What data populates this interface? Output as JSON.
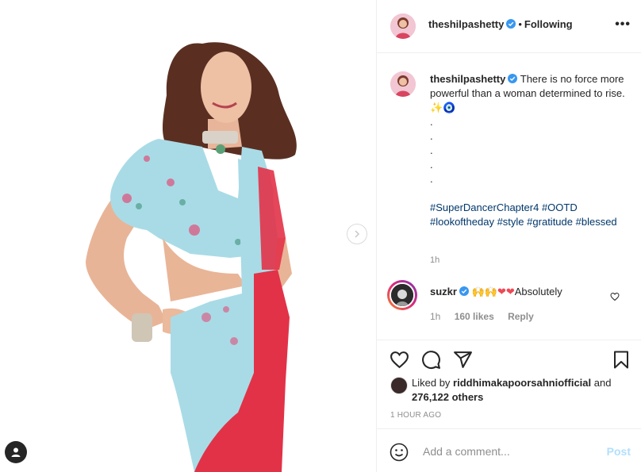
{
  "post": {
    "username": "theshilpashetty",
    "follow_state": "Following",
    "more_label": "•••",
    "separator": "•"
  },
  "caption": {
    "username": "theshilpashetty",
    "text": "There is no force more powerful than a woman determined to rise.",
    "emojis": "✨🧿",
    "dots": [
      ".",
      ".",
      ".",
      ".",
      "."
    ],
    "hashtags": [
      "#SuperDancerChapter4",
      "#OOTD",
      "#lookoftheday",
      "#style",
      "#gratitude",
      "#blessed"
    ],
    "time": "1h"
  },
  "comment": {
    "username": "suzkr",
    "emojis_fold": "🙌🙌",
    "emojis_heart": "❤❤",
    "text": "Absolutely",
    "time": "1h",
    "likes": "160 likes",
    "reply": "Reply"
  },
  "likes": {
    "prefix": "Liked by",
    "user": "riddhimakapoorsahniofficial",
    "and": "and",
    "others": "276,122 others"
  },
  "post_time": "1 HOUR AGO",
  "add_comment": {
    "placeholder": "Add a comment...",
    "post_label": "Post"
  },
  "colors": {
    "link": "#00376b",
    "verified": "#3897f0",
    "muted": "#8e8e8e",
    "post_disabled": "#b2dffc",
    "heart": "#ed4956"
  },
  "icons": {
    "next": "chevron-right-icon",
    "user_tag": "user-tag-icon",
    "verified": "verified-badge-icon",
    "more": "more-options-icon",
    "like": "heart-icon",
    "comment": "comment-icon",
    "share": "share-icon",
    "save": "bookmark-icon",
    "emoji": "emoji-icon"
  }
}
